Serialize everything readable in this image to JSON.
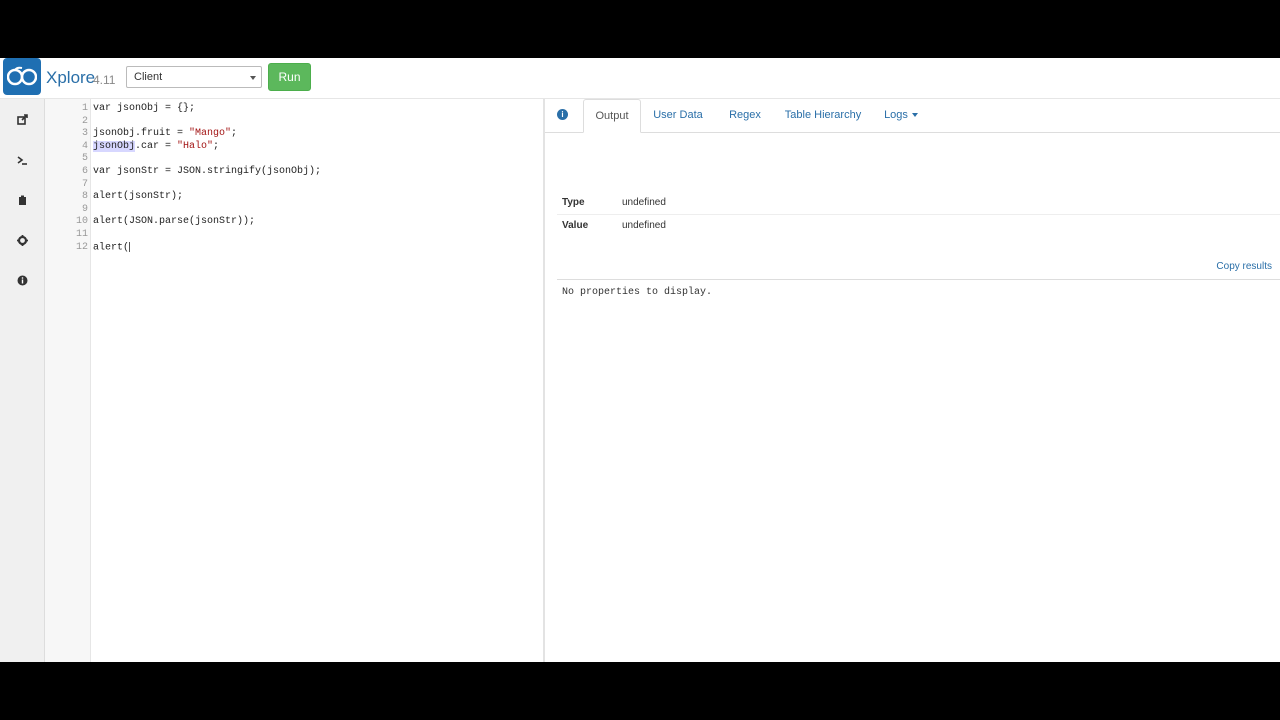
{
  "app": {
    "name": "Xplore",
    "version": "4.11"
  },
  "toolbar": {
    "scope_value": "Client",
    "run_label": "Run"
  },
  "sidebar": {
    "icons": [
      "external-link-icon",
      "terminal-icon",
      "clipboard-icon",
      "gear-icon",
      "info-icon"
    ]
  },
  "editor": {
    "lines": [
      {
        "n": "1",
        "t": "var jsonObj = {};"
      },
      {
        "n": "2",
        "t": ""
      },
      {
        "n": "3",
        "t": "jsonObj.fruit = \"Mango\";"
      },
      {
        "n": "4",
        "t": "jsonObj.car = \"Halo\";"
      },
      {
        "n": "5",
        "t": ""
      },
      {
        "n": "6",
        "t": "var jsonStr = JSON.stringify(jsonObj);"
      },
      {
        "n": "7",
        "t": ""
      },
      {
        "n": "8",
        "t": "alert(jsonStr);"
      },
      {
        "n": "9",
        "t": ""
      },
      {
        "n": "10",
        "t": "alert(JSON.parse(jsonStr));"
      },
      {
        "n": "11",
        "t": ""
      },
      {
        "n": "12",
        "t": "alert("
      }
    ]
  },
  "output": {
    "tabs": {
      "output": "Output",
      "user_data": "User Data",
      "regex": "Regex",
      "table_hierarchy": "Table Hierarchy",
      "logs": "Logs"
    },
    "type_label": "Type",
    "type_value": "undefined",
    "value_label": "Value",
    "value_value": "undefined",
    "copy_label": "Copy results",
    "no_props": "No properties to display."
  }
}
